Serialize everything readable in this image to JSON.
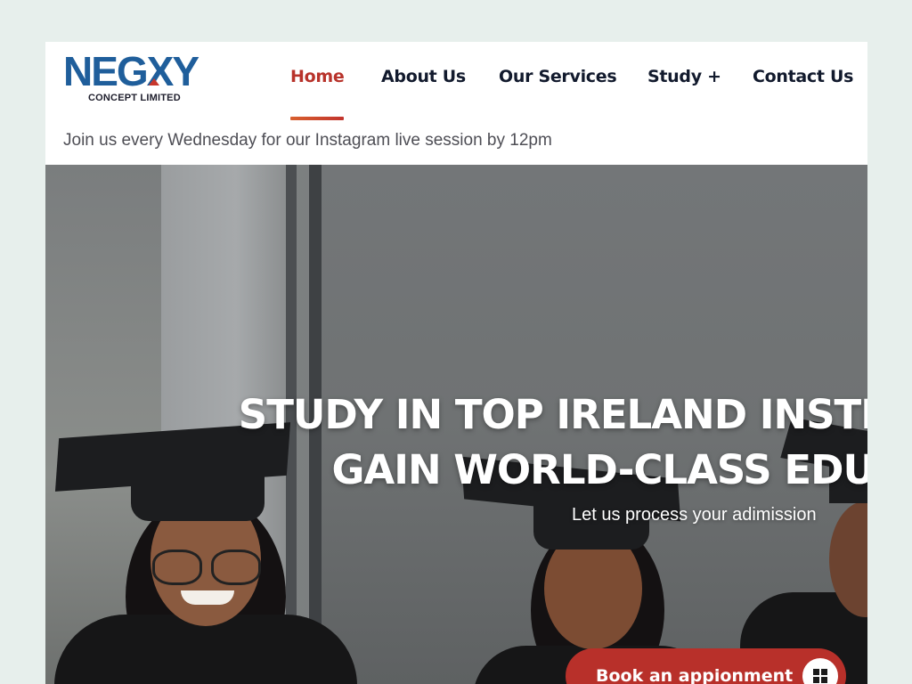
{
  "brand": {
    "logo_text": "NEGXY",
    "logo_subtext": "CONCEPT LIMITED",
    "logo_color": "#1f5e9b",
    "accent_color": "#b8302a"
  },
  "nav": {
    "items": [
      {
        "label": "Home",
        "active": true
      },
      {
        "label": "About Us",
        "active": false
      },
      {
        "label": "Our Services",
        "active": false
      },
      {
        "label": "Study +",
        "active": false
      },
      {
        "label": "Contact Us",
        "active": false
      }
    ]
  },
  "announcement": "Join us every Wednesday for our Instagram live session by 12pm",
  "hero": {
    "title_line1": "STUDY IN TOP IRELAND INSTI",
    "title_line2": "GAIN WORLD-CLASS EDU",
    "subtitle": "Let us process your adimission",
    "cta_label": "Book an appionment",
    "cta_icon": "grid-icon"
  }
}
